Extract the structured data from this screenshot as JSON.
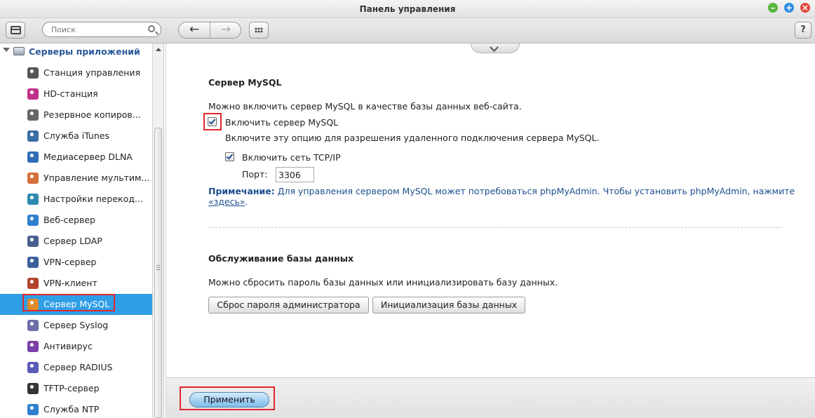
{
  "window": {
    "title": "Панель управления"
  },
  "toolbar": {
    "search_placeholder": "Поиск",
    "help_label": "?"
  },
  "sidebar": {
    "header": "Серверы приложений",
    "items": [
      {
        "label": "Станция управления",
        "icon": "surveillance-station-icon",
        "color": "#555555"
      },
      {
        "label": "HD-станция",
        "icon": "hd-station-icon",
        "color": "#c0308a"
      },
      {
        "label": "Резервное копиров...",
        "icon": "backup-icon",
        "color": "#666666"
      },
      {
        "label": "Служба iTunes",
        "icon": "itunes-icon",
        "color": "#3a6ea5"
      },
      {
        "label": "Медиасервер DLNA",
        "icon": "dlna-icon",
        "color": "#2f6fb5"
      },
      {
        "label": "Управление мультим...",
        "icon": "multimedia-icon",
        "color": "#d46f3a"
      },
      {
        "label": "Настройки перекод...",
        "icon": "transcode-icon",
        "color": "#2d8ab0"
      },
      {
        "label": "Веб-сервер",
        "icon": "web-server-icon",
        "color": "#2f7fd0"
      },
      {
        "label": "Сервер LDAP",
        "icon": "ldap-icon",
        "color": "#4a5f8f"
      },
      {
        "label": "VPN-сервер",
        "icon": "vpn-server-icon",
        "color": "#3b5f9a"
      },
      {
        "label": "VPN-клиент",
        "icon": "vpn-client-icon",
        "color": "#b4432e"
      },
      {
        "label": "Сервер MySQL",
        "icon": "mysql-icon",
        "color": "#e08a2a",
        "active": true
      },
      {
        "label": "Сервер Syslog",
        "icon": "syslog-icon",
        "color": "#6d6da8"
      },
      {
        "label": "Антивирус",
        "icon": "antivirus-icon",
        "color": "#7a3fa8"
      },
      {
        "label": "Сервер RADIUS",
        "icon": "radius-icon",
        "color": "#5a5ab8"
      },
      {
        "label": "TFTP-сервер",
        "icon": "tftp-icon",
        "color": "#333333"
      },
      {
        "label": "Служба NTP",
        "icon": "ntp-icon",
        "color": "#2f7fd0"
      }
    ]
  },
  "main": {
    "mysql": {
      "title": "Сервер MySQL",
      "description": "Можно включить сервер MySQL в качестве базы данных веб-сайта.",
      "enable_label": "Включить сервер MySQL",
      "enable_checked": true,
      "enable_hint": "Включите эту опцию для разрешения удаленного подключения сервера MySQL.",
      "tcp_label": "Включить сеть TCP/IP",
      "tcp_checked": true,
      "port_label": "Порт:",
      "port_value": "3306",
      "note_prefix": "Примечание:",
      "note_text": " Для управления сервером MySQL может потребоваться phpMyAdmin. Чтобы установить phpMyAdmin, нажмите ",
      "note_link": "«здесь»",
      "note_suffix": "."
    },
    "maintenance": {
      "title": "Обслуживание базы данных",
      "description": "Можно сбросить пароль базы данных или инициализировать базу данных.",
      "reset_button": "Сброс пароля администратора",
      "init_button": "Инициализация базы данных"
    }
  },
  "footer": {
    "apply_button": "Применить"
  },
  "colors": {
    "active_item": "#2e9ee6",
    "highlight_frame": "#e1272f",
    "note_text": "#1d4f8f"
  }
}
